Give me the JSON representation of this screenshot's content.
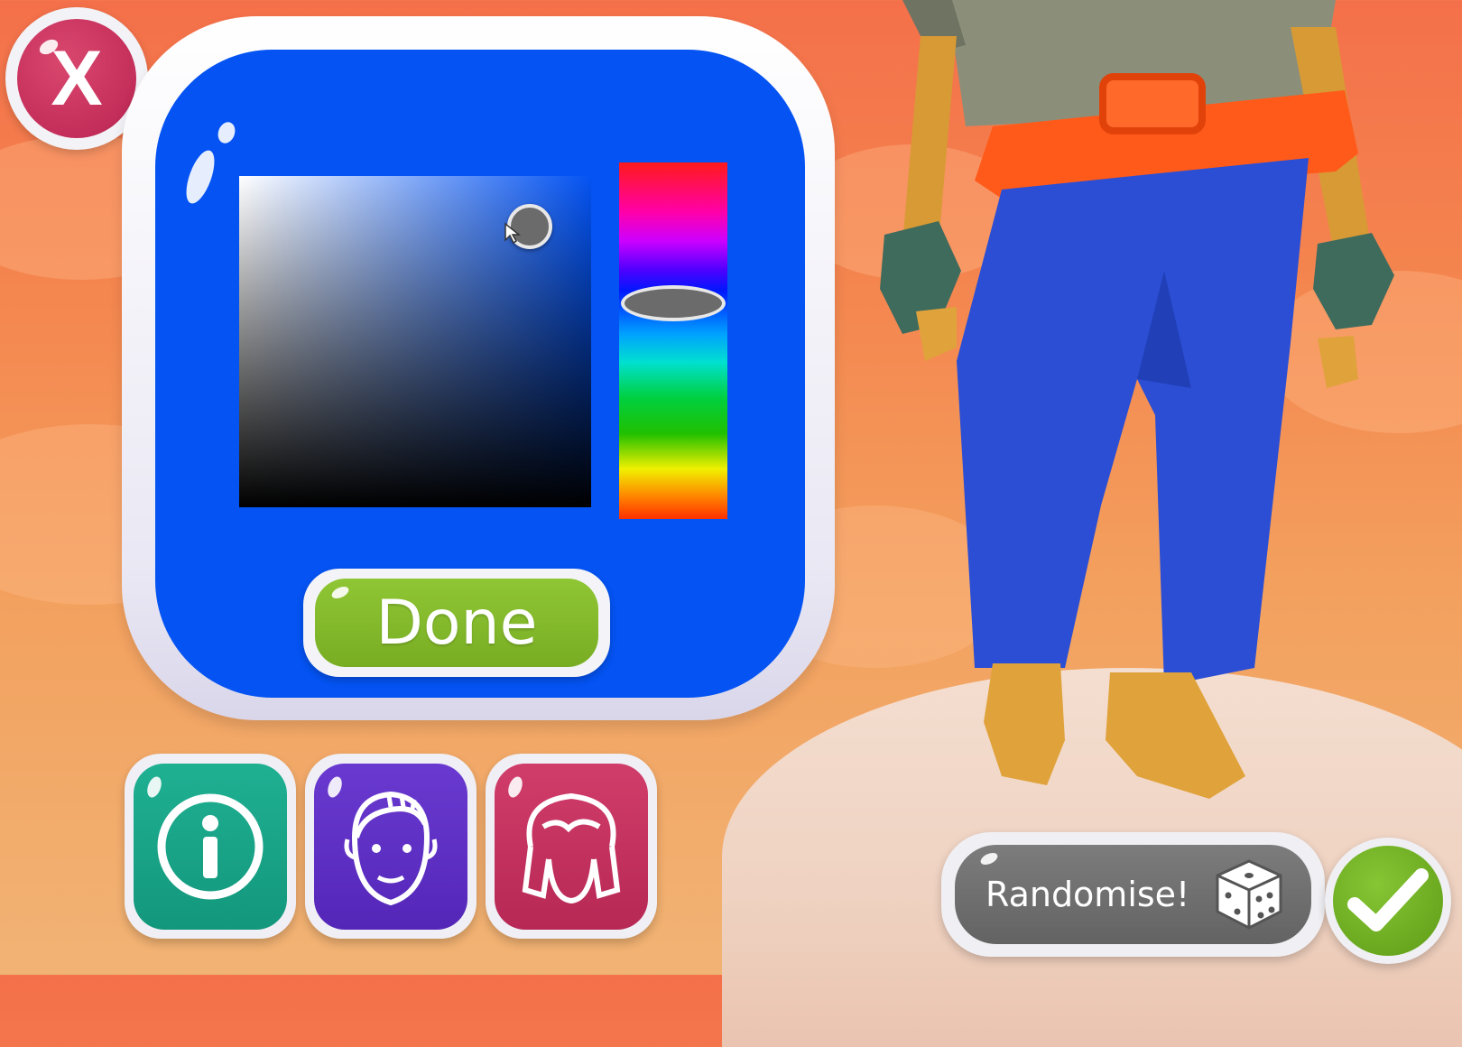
{
  "close_button": {
    "label": "X",
    "icon": "close-icon"
  },
  "color_picker": {
    "selected_hue_color": "#0453f2",
    "hue_position_fraction": 0.39,
    "saturation_fraction": 0.82,
    "value_fraction": 0.91,
    "done_label": "Done"
  },
  "tabs": [
    {
      "name": "info",
      "icon": "info-icon",
      "color": "#1aa486"
    },
    {
      "name": "face",
      "icon": "face-icon",
      "color": "#5f30c4"
    },
    {
      "name": "hair",
      "icon": "hair-icon",
      "color": "#c43260"
    }
  ],
  "randomise": {
    "label": "Randomise!",
    "icon": "dice-icon"
  },
  "confirm": {
    "icon": "checkmark-icon"
  },
  "character": {
    "shirt_color": "#8b8f7a",
    "belt_color": "#ff5a1a",
    "pants_color": "#2b4ed4",
    "skin_color": "#e0a23a",
    "gloves_color": "#3f6b5d"
  }
}
